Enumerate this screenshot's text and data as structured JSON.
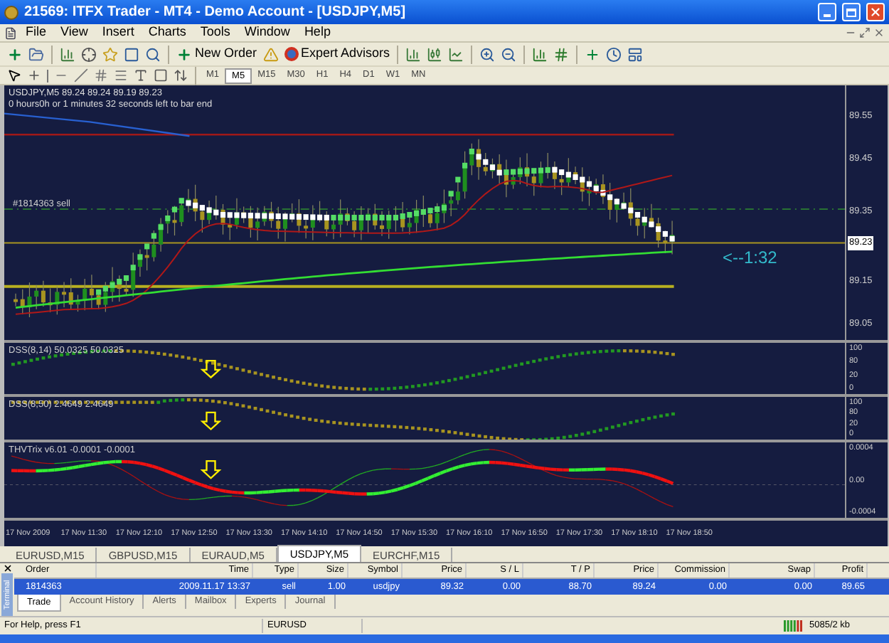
{
  "window": {
    "title": "21569: ITFX Trader - MT4 - Demo Account - [USDJPY,M5]"
  },
  "menu": [
    "File",
    "View",
    "Insert",
    "Charts",
    "Tools",
    "Window",
    "Help"
  ],
  "toolbar": {
    "new_order": "New Order",
    "expert_advisors": "Expert Advisors"
  },
  "timeframes": [
    {
      "label": "M1",
      "selected": false
    },
    {
      "label": "M5",
      "selected": true
    },
    {
      "label": "M15",
      "selected": false
    },
    {
      "label": "M30",
      "selected": false
    },
    {
      "label": "H1",
      "selected": false
    },
    {
      "label": "H4",
      "selected": false
    },
    {
      "label": "D1",
      "selected": false
    },
    {
      "label": "W1",
      "selected": false
    },
    {
      "label": "MN",
      "selected": false
    }
  ],
  "chart": {
    "header": "USDJPY,M5  89.24 89.24 89.19 89.23",
    "countdown_info": "0 hours0h or 1 minutes 32 seconds left to bar end",
    "order_label": "#1814363 sell",
    "countdown": "<--1:32",
    "price_axis": [
      "89.55",
      "89.45",
      "89.35",
      "89.15",
      "89.05"
    ],
    "current_price": "89.23",
    "indicators": [
      {
        "title": "DSS(8,14) 50.0325 50.0325",
        "axis": [
          "100",
          "80",
          "20",
          "0"
        ]
      },
      {
        "title": "DSS(8,50) 2.4649 2.4649",
        "axis": [
          "100",
          "80",
          "20",
          "0"
        ]
      },
      {
        "title": "THVTrix v6.01 -0.0001 -0.0001",
        "axis": [
          "0.0004",
          "0.00",
          "-0.0004"
        ]
      }
    ],
    "time_axis": [
      "17 Nov 2009",
      "17 Nov 11:30",
      "17 Nov 12:10",
      "17 Nov 12:50",
      "17 Nov 13:30",
      "17 Nov 14:10",
      "17 Nov 14:50",
      "17 Nov 15:30",
      "17 Nov 16:10",
      "17 Nov 16:50",
      "17 Nov 17:30",
      "17 Nov 18:10",
      "17 Nov 18:50"
    ]
  },
  "chart_tabs": [
    {
      "label": "EURUSD,M15",
      "selected": false
    },
    {
      "label": "GBPUSD,M15",
      "selected": false
    },
    {
      "label": "EURAUD,M5",
      "selected": false
    },
    {
      "label": "USDJPY,M5",
      "selected": true
    },
    {
      "label": "EURCHF,M15",
      "selected": false
    }
  ],
  "terminal": {
    "side_label": "Terminal",
    "columns": [
      "Order",
      "Time",
      "Type",
      "Size",
      "Symbol",
      "Price",
      "S / L",
      "T / P",
      "Price",
      "Commission",
      "Swap",
      "Profit"
    ],
    "rows": [
      {
        "selected": true,
        "cells": [
          "1814363",
          "2009.11.17 13:37",
          "sell",
          "1.00",
          "usdjpy",
          "89.32",
          "0.00",
          "88.70",
          "89.24",
          "0.00",
          "0.00",
          "89.65"
        ]
      }
    ],
    "tabs": [
      {
        "label": "Trade",
        "selected": true
      },
      {
        "label": "Account History",
        "selected": false
      },
      {
        "label": "Alerts",
        "selected": false
      },
      {
        "label": "Mailbox",
        "selected": false
      },
      {
        "label": "Experts",
        "selected": false
      },
      {
        "label": "Journal",
        "selected": false
      }
    ]
  },
  "status_bar": {
    "help": "For Help, press F1",
    "symbol": "EURUSD",
    "traffic": "5085/2 kb"
  }
}
